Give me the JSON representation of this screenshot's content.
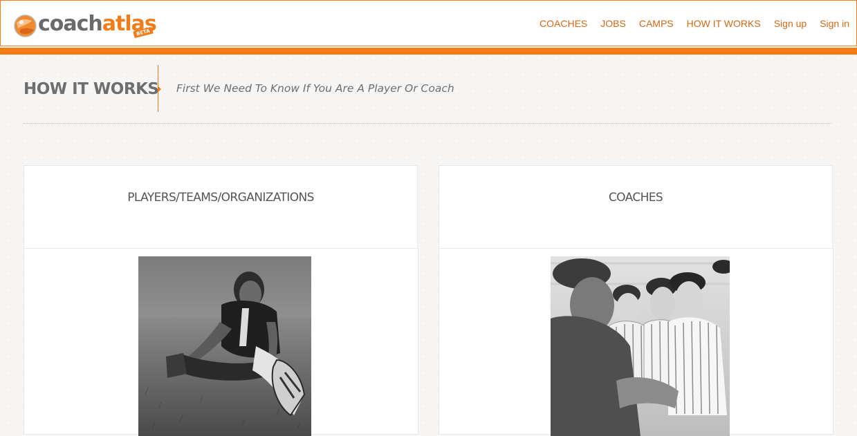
{
  "brand": {
    "name_part1": "coach",
    "name_part2": "atlas",
    "badge": "BETA"
  },
  "nav": {
    "items": [
      {
        "label": "COACHES"
      },
      {
        "label": "JOBS"
      },
      {
        "label": "CAMPS"
      },
      {
        "label": "HOW IT WORKS"
      },
      {
        "label": "Sign up"
      },
      {
        "label": "Sign in"
      }
    ]
  },
  "page": {
    "title": "HOW IT WORKS",
    "subtitle": "First We Need To Know If You Are A Player Or Coach"
  },
  "cards": [
    {
      "title": "PLAYERS/TEAMS/ORGANIZATIONS",
      "photo_icon": "player-stretching-photo"
    },
    {
      "title": "COACHES",
      "photo_icon": "coach-with-team-photo"
    }
  ],
  "colors": {
    "accent": "#f07c1a",
    "nav_text": "#d0691a",
    "heading_text": "#6e6e6e"
  }
}
